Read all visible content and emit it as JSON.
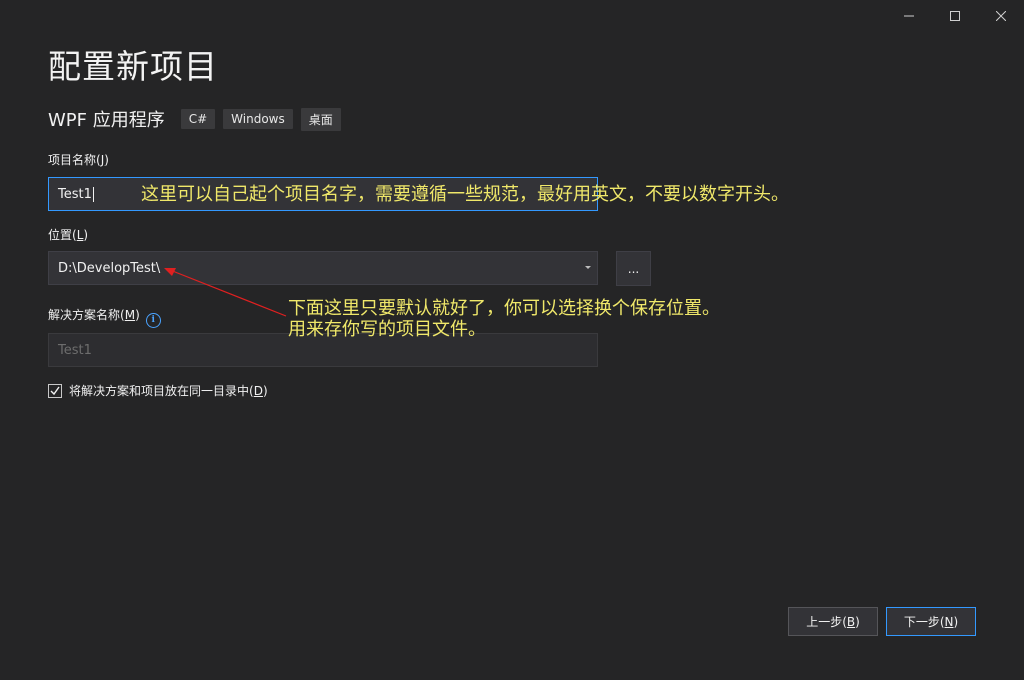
{
  "window": {
    "controls": [
      "minimize-icon",
      "maximize-icon",
      "close-icon"
    ]
  },
  "header": {
    "title": "配置新项目",
    "project_type": "WPF 应用程序",
    "tags": [
      "C#",
      "Windows",
      "桌面"
    ]
  },
  "form": {
    "project_name_label": "项目名称",
    "project_name_key": "J",
    "project_name_value": "Test1",
    "location_label": "位置",
    "location_key": "L",
    "location_value": "D:\\DevelopTest\\",
    "browse_label": "...",
    "solution_name_label": "解决方案名称",
    "solution_name_key": "M",
    "solution_name_placeholder": "Test1",
    "same_dir_label": "将解决方案和项目放在同一目录中",
    "same_dir_key": "D",
    "same_dir_checked": true
  },
  "annotations": {
    "note1": "这里可以自己起个项目名字，需要遵循一些规范，最好用英文，不要以数字开头。",
    "note2_line1": "下面这里只要默认就好了，你可以选择换个保存位置。",
    "note2_line2": "用来存你写的项目文件。",
    "color": "#f0e86a",
    "arrow_color": "#e02020"
  },
  "footer": {
    "back_label": "上一步",
    "back_key": "B",
    "next_label": "下一步",
    "next_key": "N"
  },
  "colors": {
    "background": "#252526",
    "input_bg": "#333337",
    "focus_border": "#3399ff",
    "info_icon": "#4aa3ff"
  }
}
